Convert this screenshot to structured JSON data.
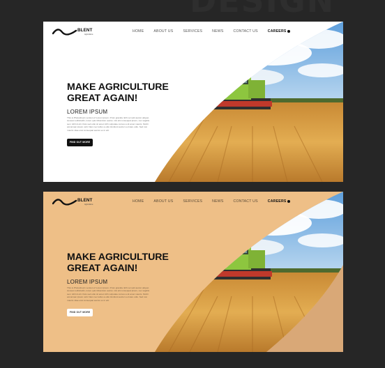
{
  "background_word": "DESIGN",
  "brand": {
    "name": "BLENT",
    "tagline": "Agriculture"
  },
  "nav": {
    "items": [
      "HOME",
      "ABOUT US",
      "SERVICES",
      "NEWS",
      "CONTACT US",
      "CAREERS"
    ]
  },
  "hero": {
    "title_line1": "MAKE AGRICULTURE",
    "title_line2": "GREAT AGAIN!",
    "subtitle": "LOREM IPSUM",
    "body": "This is Photoshop's version of Lorem Ipsum. Proin gravida nibh vel velit auctor aliquet. Aenean sollicitudin, lorem quis bibendum auctor, nisi elit consequat ipsum, nec sagittis sem nibh id elit. Duis sed odio sit amet nibh vulputate cursus a sit amet mauris. Morbi accumsan ipsum velit. Nam nec tellus a odio tincidunt auctor a ornare odio. Sed non mauris vitae erat consequat auctor eu in elit.",
    "cta_label": "FIND OUT MORE"
  },
  "variants": [
    {
      "name": "white",
      "background": "#ffffff",
      "cta_background": "#111111"
    },
    {
      "name": "peach",
      "background": "#eebf87",
      "cta_background": "#ffffff"
    }
  ],
  "colors": {
    "page_background": "#262626",
    "sky": "#6fa9de",
    "wheat": "#d99a3a",
    "combine_green": "#8dc63f"
  }
}
